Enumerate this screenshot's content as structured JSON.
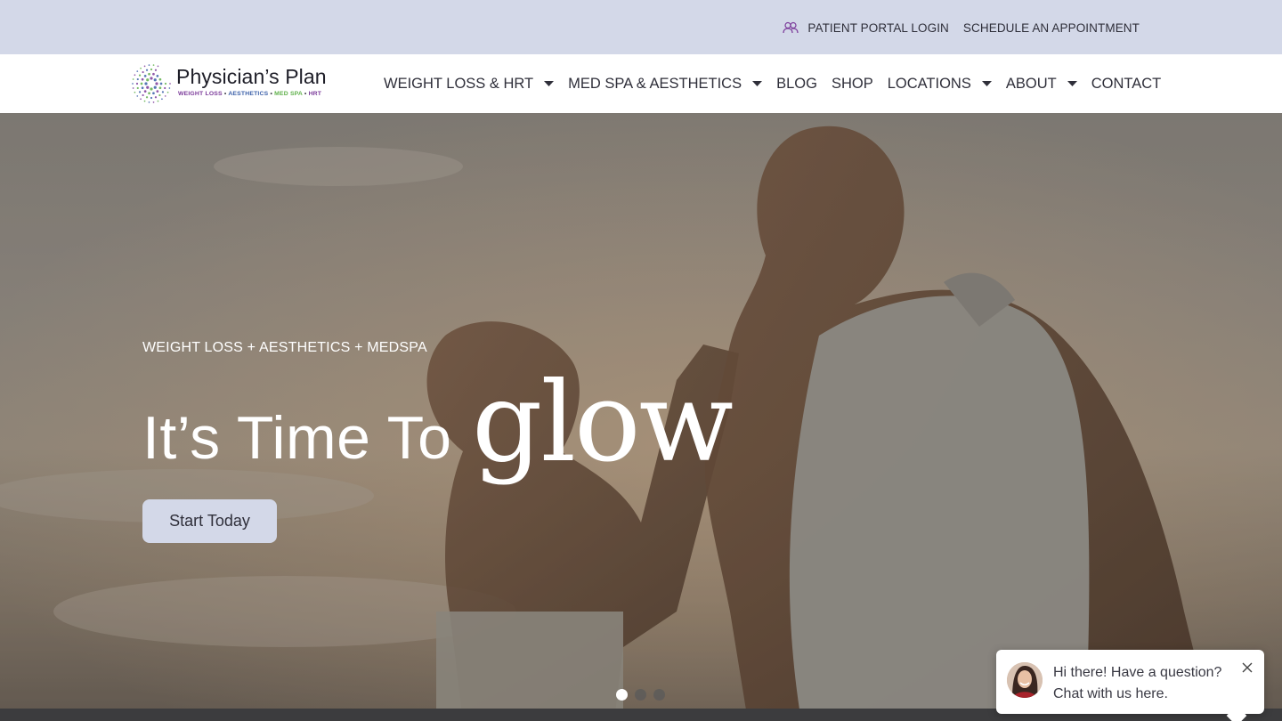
{
  "topbar": {
    "portal_label": "PATIENT PORTAL LOGIN",
    "portal_icon": "users-icon",
    "schedule_label": "SCHEDULE AN APPOINTMENT"
  },
  "brand": {
    "name": "Physician’s Plan",
    "tagline": {
      "part1": "WEIGHT LOSS",
      "part2": "AESTHETICS",
      "part3": "MED SPA",
      "part4": "HRT",
      "sep": "•"
    }
  },
  "nav": {
    "items": [
      {
        "label": "WEIGHT LOSS & HRT",
        "has_dropdown": true
      },
      {
        "label": "MED SPA & AESTHETICS",
        "has_dropdown": true
      },
      {
        "label": "BLOG",
        "has_dropdown": false
      },
      {
        "label": "SHOP",
        "has_dropdown": false
      },
      {
        "label": "LOCATIONS",
        "has_dropdown": true
      },
      {
        "label": "ABOUT",
        "has_dropdown": true
      },
      {
        "label": "CONTACT",
        "has_dropdown": false
      }
    ]
  },
  "hero": {
    "eyebrow": "WEIGHT LOSS + AESTHETICS + MEDSPA",
    "headline_main": "It’s Time To",
    "headline_accent": "glow",
    "cta_label": "Start Today",
    "slides_count": 3,
    "active_slide": 1
  },
  "chat": {
    "line1": "Hi there! Have a question?",
    "line2": "Chat with us here.",
    "close_icon": "close-icon"
  },
  "colors": {
    "topbar_bg": "#d3d8e8",
    "text_dark": "#2f2f3a",
    "brand_purple": "#7b3a9a",
    "brand_blue": "#3a5fa8",
    "brand_green": "#5fb04a"
  }
}
